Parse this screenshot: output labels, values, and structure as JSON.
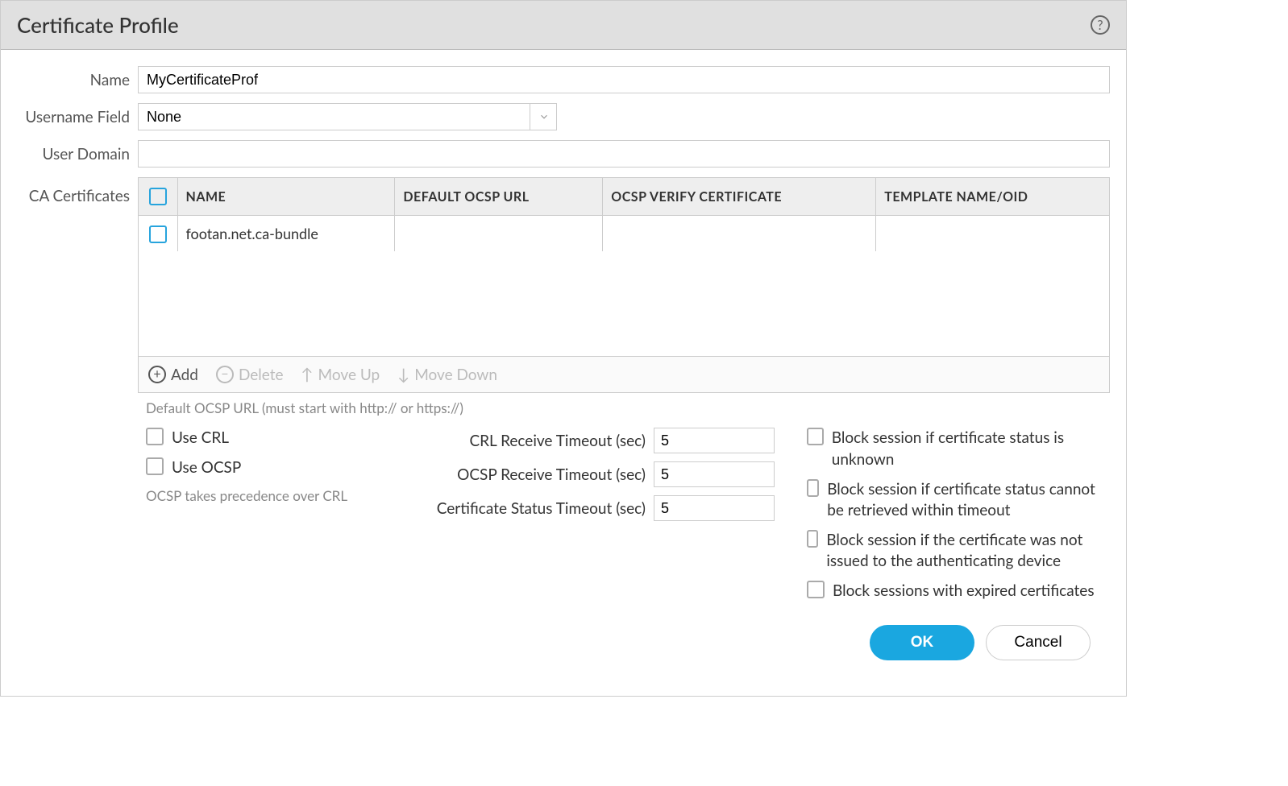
{
  "header": {
    "title": "Certificate Profile"
  },
  "labels": {
    "name": "Name",
    "username_field": "Username Field",
    "user_domain": "User Domain",
    "ca_certificates": "CA Certificates"
  },
  "fields": {
    "name_value": "MyCertificateProf",
    "username_field_value": "None",
    "user_domain_value": ""
  },
  "ca_table": {
    "columns": {
      "name": "NAME",
      "default_ocsp_url": "DEFAULT OCSP URL",
      "ocsp_verify_cert": "OCSP VERIFY CERTIFICATE",
      "template_name": "TEMPLATE NAME/OID"
    },
    "rows": [
      {
        "name": "footan.net.ca-bundle",
        "default_ocsp_url": "",
        "ocsp_verify_cert": "",
        "template_name": ""
      }
    ]
  },
  "toolbar": {
    "add": "Add",
    "delete": "Delete",
    "move_up": "Move Up",
    "move_down": "Move Down"
  },
  "hint": {
    "default_ocsp": "Default OCSP URL (must start with http:// or https://)",
    "ocsp_precedence": "OCSP takes precedence over CRL"
  },
  "checks": {
    "use_crl": "Use CRL",
    "use_ocsp": "Use OCSP",
    "block_unknown": "Block session if certificate status is unknown",
    "block_timeout": "Block session if certificate status cannot be retrieved within timeout",
    "block_not_issued": "Block session if the certificate was not issued to the authenticating device",
    "block_expired": "Block sessions with expired certificates"
  },
  "timeouts": {
    "crl_label": "CRL Receive Timeout (sec)",
    "crl_value": "5",
    "ocsp_label": "OCSP Receive Timeout (sec)",
    "ocsp_value": "5",
    "cert_status_label": "Certificate Status Timeout (sec)",
    "cert_status_value": "5"
  },
  "footer": {
    "ok": "OK",
    "cancel": "Cancel"
  }
}
